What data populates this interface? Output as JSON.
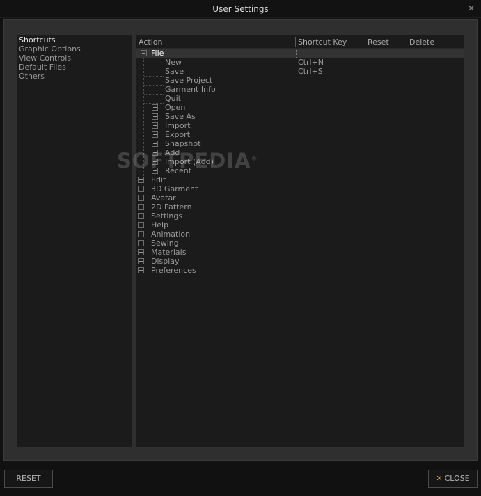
{
  "window": {
    "title": "User Settings"
  },
  "categories": [
    "Shortcuts",
    "Graphic Options",
    "View Controls",
    "Default Files",
    "Others"
  ],
  "columns": {
    "action": "Action",
    "shortcut": "Shortcut Key",
    "reset": "Reset",
    "delete": "Delete"
  },
  "tree": {
    "file": {
      "label": "File",
      "children": [
        {
          "label": "New",
          "shortcut": "Ctrl+N"
        },
        {
          "label": "Save",
          "shortcut": "Ctrl+S"
        },
        {
          "label": "Save Project",
          "shortcut": ""
        },
        {
          "label": "Garment Info",
          "shortcut": ""
        },
        {
          "label": "Quit",
          "shortcut": ""
        },
        {
          "label": "Open",
          "shortcut": ""
        },
        {
          "label": "Save As",
          "shortcut": ""
        },
        {
          "label": "Import",
          "shortcut": ""
        },
        {
          "label": "Export",
          "shortcut": ""
        },
        {
          "label": "Snapshot",
          "shortcut": ""
        },
        {
          "label": "Add",
          "shortcut": ""
        },
        {
          "label": "Import (Add)",
          "shortcut": ""
        },
        {
          "label": "Recent",
          "shortcut": ""
        }
      ]
    },
    "groups": [
      "Edit",
      "3D Garment",
      "Avatar",
      "2D Pattern",
      "Settings",
      "Help",
      "Animation",
      "Sewing",
      "Materials",
      "Display",
      "Preferences"
    ]
  },
  "buttons": {
    "reset": "RESET",
    "close": "CLOSE"
  },
  "watermark": {
    "text": "SOFTPEDIA",
    "mark": "®"
  },
  "icons": {
    "window_close": "close-icon",
    "expand": "plus-box-icon",
    "collapse": "minus-box-icon",
    "close_button": "x-icon"
  },
  "colors": {
    "background": "#111111",
    "panel": "#1b1b1b",
    "frame": "#2f2f2f",
    "close_accent": "#d9a53a"
  }
}
